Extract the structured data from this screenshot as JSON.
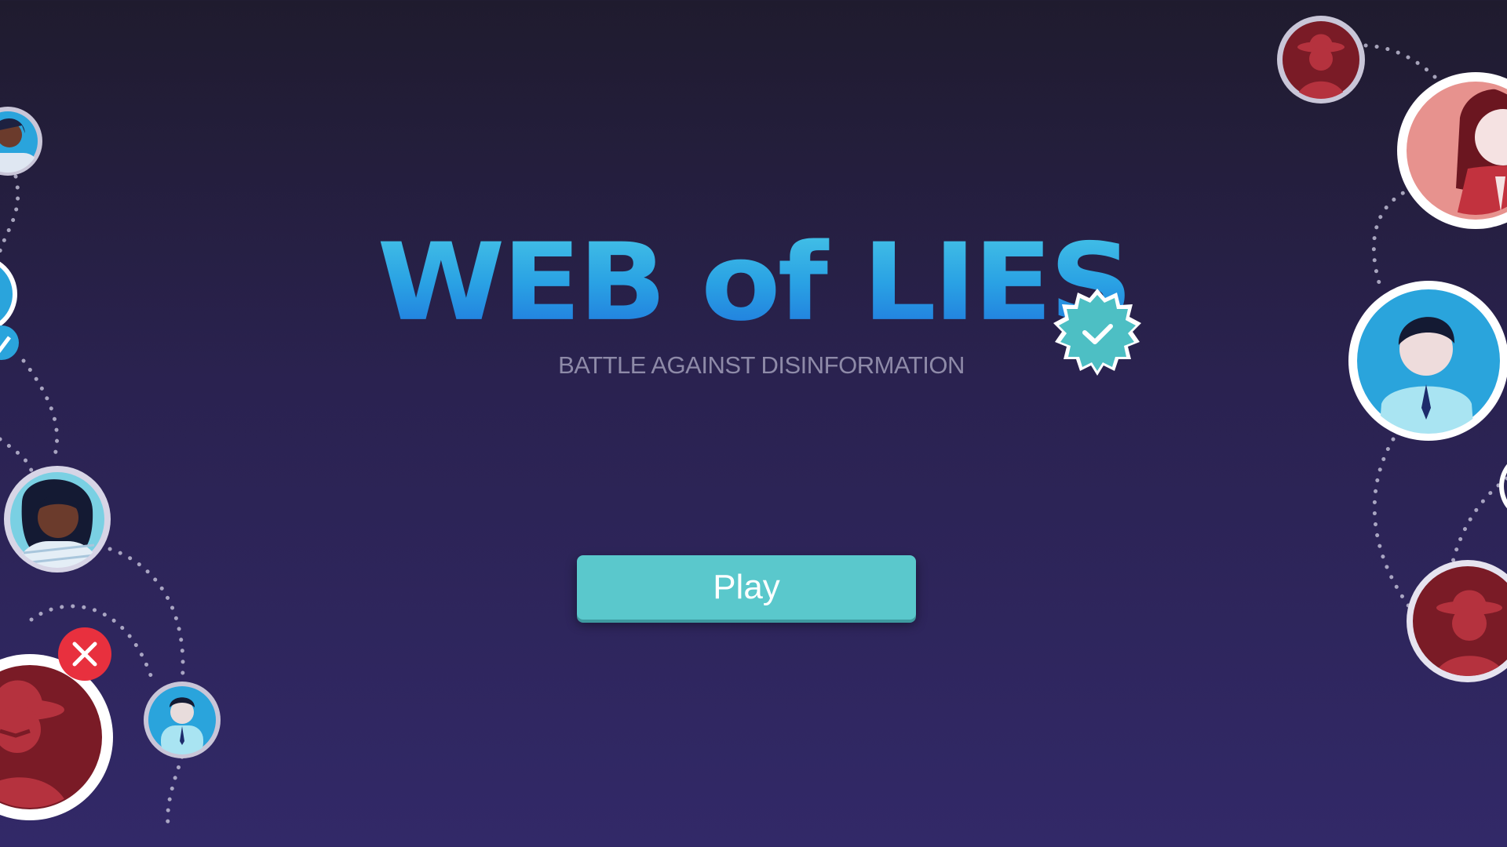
{
  "game": {
    "title": "WEB of LIES",
    "subtitle": "BATTLE AGAINST DISINFORMATION",
    "play_label": "Play"
  },
  "colors": {
    "background_top": "#1f1b2e",
    "background_bottom": "#322968",
    "title_light": "#45c3e6",
    "title_dark": "#1f78dd",
    "subtitle": "#8e8aa8",
    "play_button": "#5ac8cc",
    "verified_badge": "#4dbfc4",
    "reject_badge": "#e8303e",
    "agent_red": "#b5323e",
    "person_blue": "#2aa4dc"
  },
  "icons": {
    "verified": "verified-badge-icon",
    "reject": "reject-x-icon",
    "spy": "spy-avatar-icon",
    "person": "person-avatar-icon"
  }
}
